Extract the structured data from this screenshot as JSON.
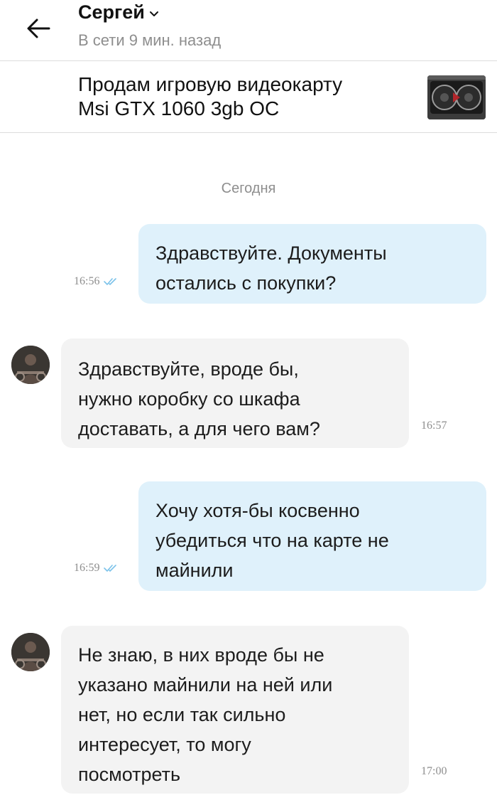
{
  "header": {
    "contact_name": "Сергей",
    "status": "В сети 9 мин. назад"
  },
  "item": {
    "title": "Продам игровую видеокарту\nMsi GTX 1060 3gb OC"
  },
  "chat": {
    "date_label": "Сегодня",
    "messages": [
      {
        "direction": "out",
        "text": "Здравствуйте. Документы\nостались с покупки?",
        "time": "16:56",
        "status": "read"
      },
      {
        "direction": "in",
        "text": "Здравствуйте, вроде бы,\nнужно коробку со шкафа\nдоставать, а для чего вам?",
        "time": "16:57"
      },
      {
        "direction": "out",
        "text": "Хочу хотя-бы косвенно\nубедиться что на карте не\nмайнили",
        "time": "16:59",
        "status": "read"
      },
      {
        "direction": "in",
        "text": "Не знаю, в них вроде бы не\nуказано майнили на ней или\nнет, но если так сильно\nинтересует, то могу\nпосмотреть",
        "time": "17:00"
      }
    ]
  },
  "colors": {
    "outgoing_bubble": "#dff1fb",
    "incoming_bubble": "#f3f3f3",
    "read_check": "#7cc3ea",
    "muted_text": "#8e8e8e"
  },
  "icons": {
    "back": "arrow-left-icon",
    "dropdown": "chevron-down-icon",
    "read": "double-check-icon"
  }
}
